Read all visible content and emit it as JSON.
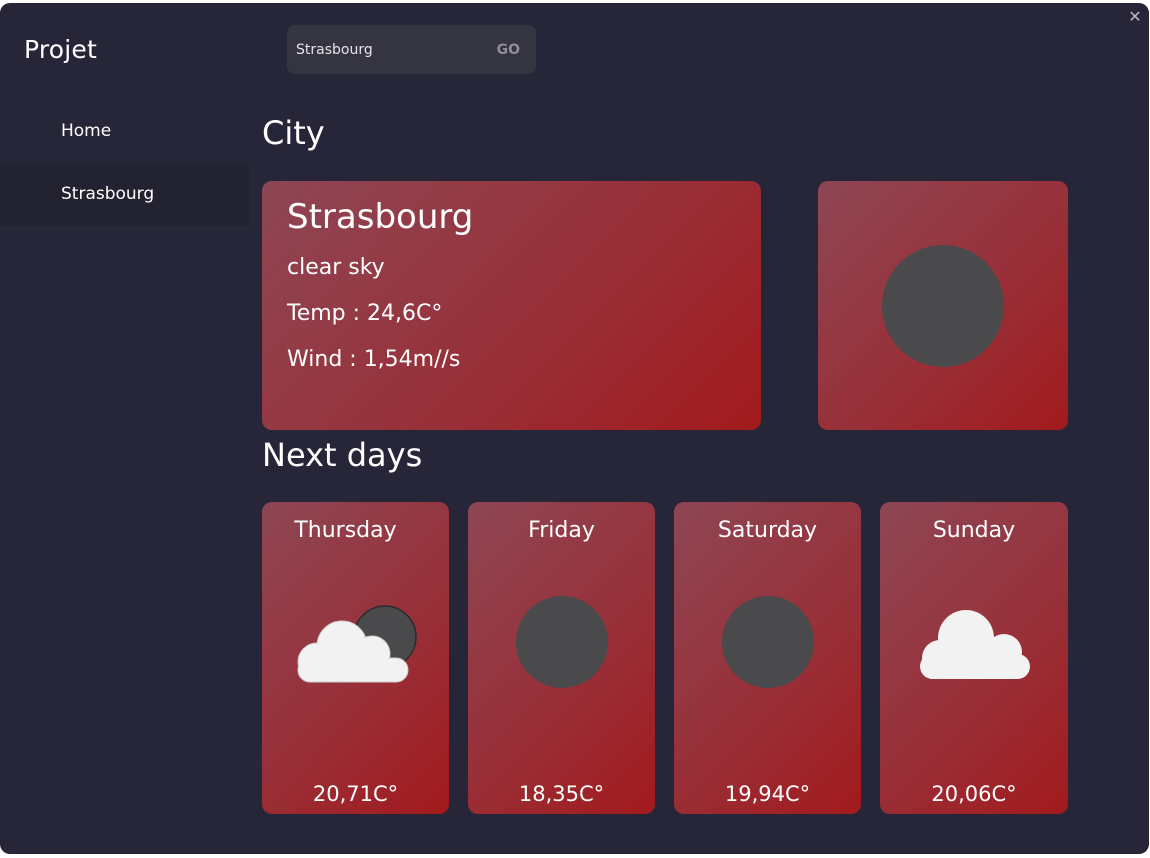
{
  "app": {
    "title": "Projet",
    "close_icon": "close-icon"
  },
  "sidebar": {
    "items": [
      {
        "label": "Home",
        "active": false
      },
      {
        "label": "Strasbourg",
        "active": true
      }
    ]
  },
  "search": {
    "value": "Strasbourg",
    "go_label": "GO"
  },
  "city_section": {
    "title": "City",
    "name": "Strasbourg",
    "description": "clear sky",
    "temp": "Temp : 24,6C°",
    "wind": "Wind : 1,54m//s",
    "icon": "clear-sky-icon"
  },
  "forecast_section": {
    "title": "Next days",
    "days": [
      {
        "day": "Thursday",
        "temp": "20,71C°",
        "icon": "cloud-with-moon-icon"
      },
      {
        "day": "Friday",
        "temp": "18,35C°",
        "icon": "clear-sky-icon"
      },
      {
        "day": "Saturday",
        "temp": "19,94C°",
        "icon": "clear-sky-icon"
      },
      {
        "day": "Sunday",
        "temp": "20,06C°",
        "icon": "cloud-icon"
      }
    ]
  },
  "colors": {
    "background": "#272639",
    "card_gradient_start": "#8e4654",
    "card_gradient_end": "#a21a1c",
    "icon_grey": "#4a4a4c"
  }
}
